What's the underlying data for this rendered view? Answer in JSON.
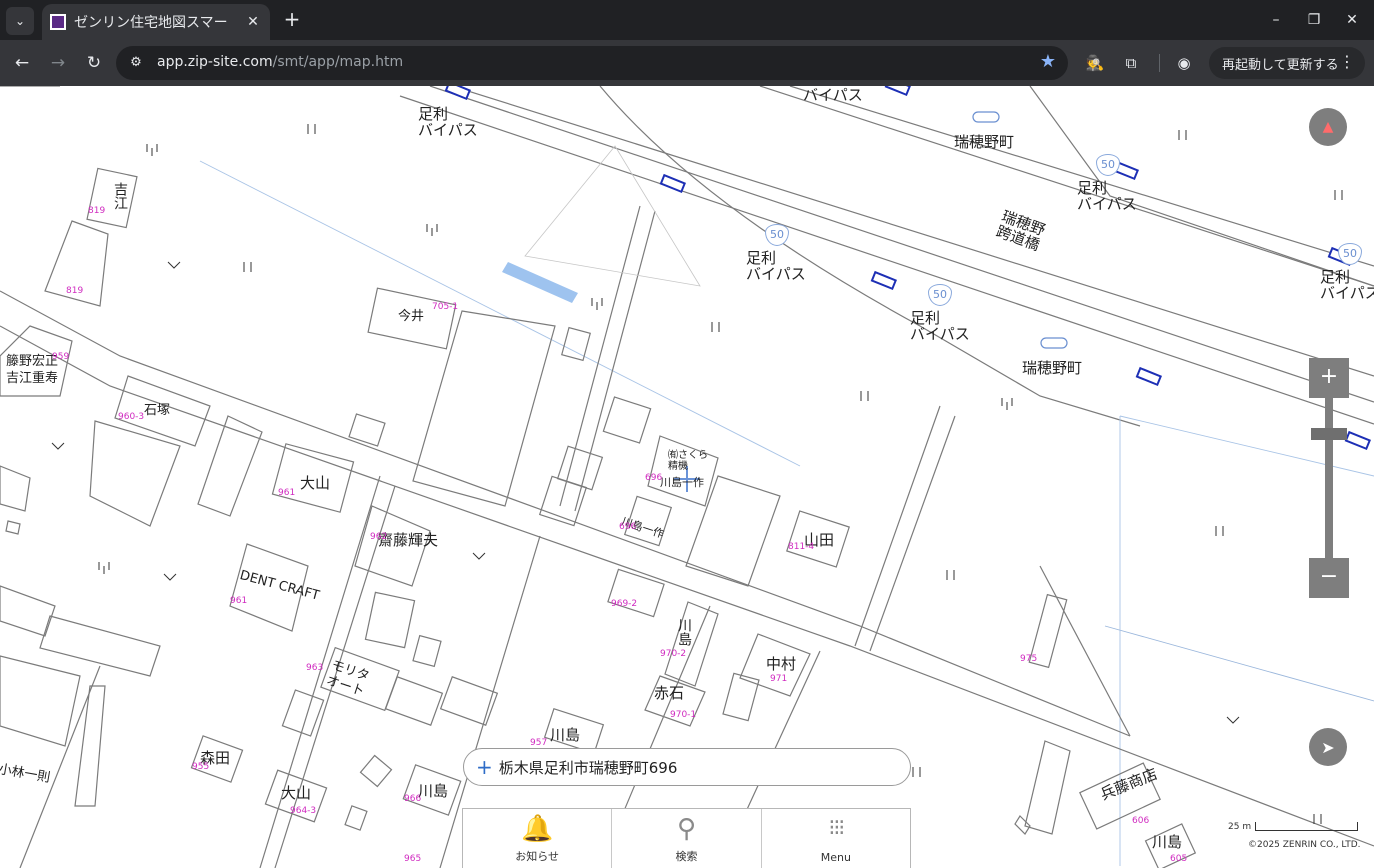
{
  "browser": {
    "tab": {
      "title": "ゼンリン住宅地図スマー"
    },
    "url": {
      "host": "app.zip-site.com",
      "path": "/smt/app/map.htm"
    },
    "relaunch_label": "再起動して更新する",
    "icons": {
      "tab_menu": "chevron-down-icon",
      "new_tab": "plus-icon",
      "back": "arrow-left-icon",
      "forward": "arrow-right-icon",
      "reload": "reload-icon",
      "site_info": "tune-icon",
      "bookmark": "star-icon",
      "extension_1": "extension-icon",
      "extensions": "puzzle-icon",
      "profile": "profile-icon"
    }
  },
  "map": {
    "labels": {
      "ashikaga_bypass_1": "足利\nバイパス",
      "ashikaga_bypass_2": "足利\nバイパス",
      "ashikaga_bypass_3": "足利\nバイパス",
      "ashikaga_bypass_4": "足利\nバイパス",
      "ashikaga_bypass_5": "足利\nバイパス",
      "bypass_top": "バイパス",
      "mizuhono_1": "瑞穂野町",
      "mizuhono_2": "瑞穂野町",
      "overpass": "瑞穂野\n跨道橋",
      "imai": "今井",
      "yoshie": "吉江",
      "fujino": "籐野宏正\n吉江重寿",
      "ishizuka": "石塚",
      "oyama_1": "大山",
      "oyama_2": "大山",
      "saito": "齋藤輝夫",
      "dent_craft": "DENT CRAFT",
      "morita": "モリタ\nオート",
      "kawashima_1": "川島一作",
      "kawashima_2": "川島一作",
      "kawashima_3": "川島",
      "kawashima_4": "川島",
      "kawashima_5": "川島",
      "kawashima_6": "川島",
      "sakura": "㈲さくら\n精機",
      "yamada": "山田",
      "nakamura": "中村",
      "akaishi": "赤石",
      "morita_2": "森田",
      "kobayashi": "小林一則",
      "hyogo": "兵藤商店",
      "route_no": "50"
    },
    "lot_numbers": [
      "705-1",
      "819",
      "819",
      "959",
      "960-3",
      "961",
      "962",
      "961",
      "963",
      "696",
      "696",
      "811-4",
      "969-2",
      "970-2",
      "971",
      "970-1",
      "957",
      "955",
      "964-3",
      "966",
      "965",
      "606",
      "605",
      "975"
    ],
    "address": "栃木県足利市瑞穂野町696",
    "scale": "25 m",
    "copyright": "©2025 ZENRIN CO., LTD.",
    "controls": {
      "compass": "compass-icon",
      "zoom_in": "+",
      "zoom_out": "−",
      "locate": "navigation-arrow-icon"
    }
  },
  "bottom_nav": [
    {
      "label": "お知らせ",
      "icon": "bell-icon"
    },
    {
      "label": "検索",
      "icon": "search-icon"
    },
    {
      "label": "Menu",
      "icon": "grid-icon"
    }
  ]
}
